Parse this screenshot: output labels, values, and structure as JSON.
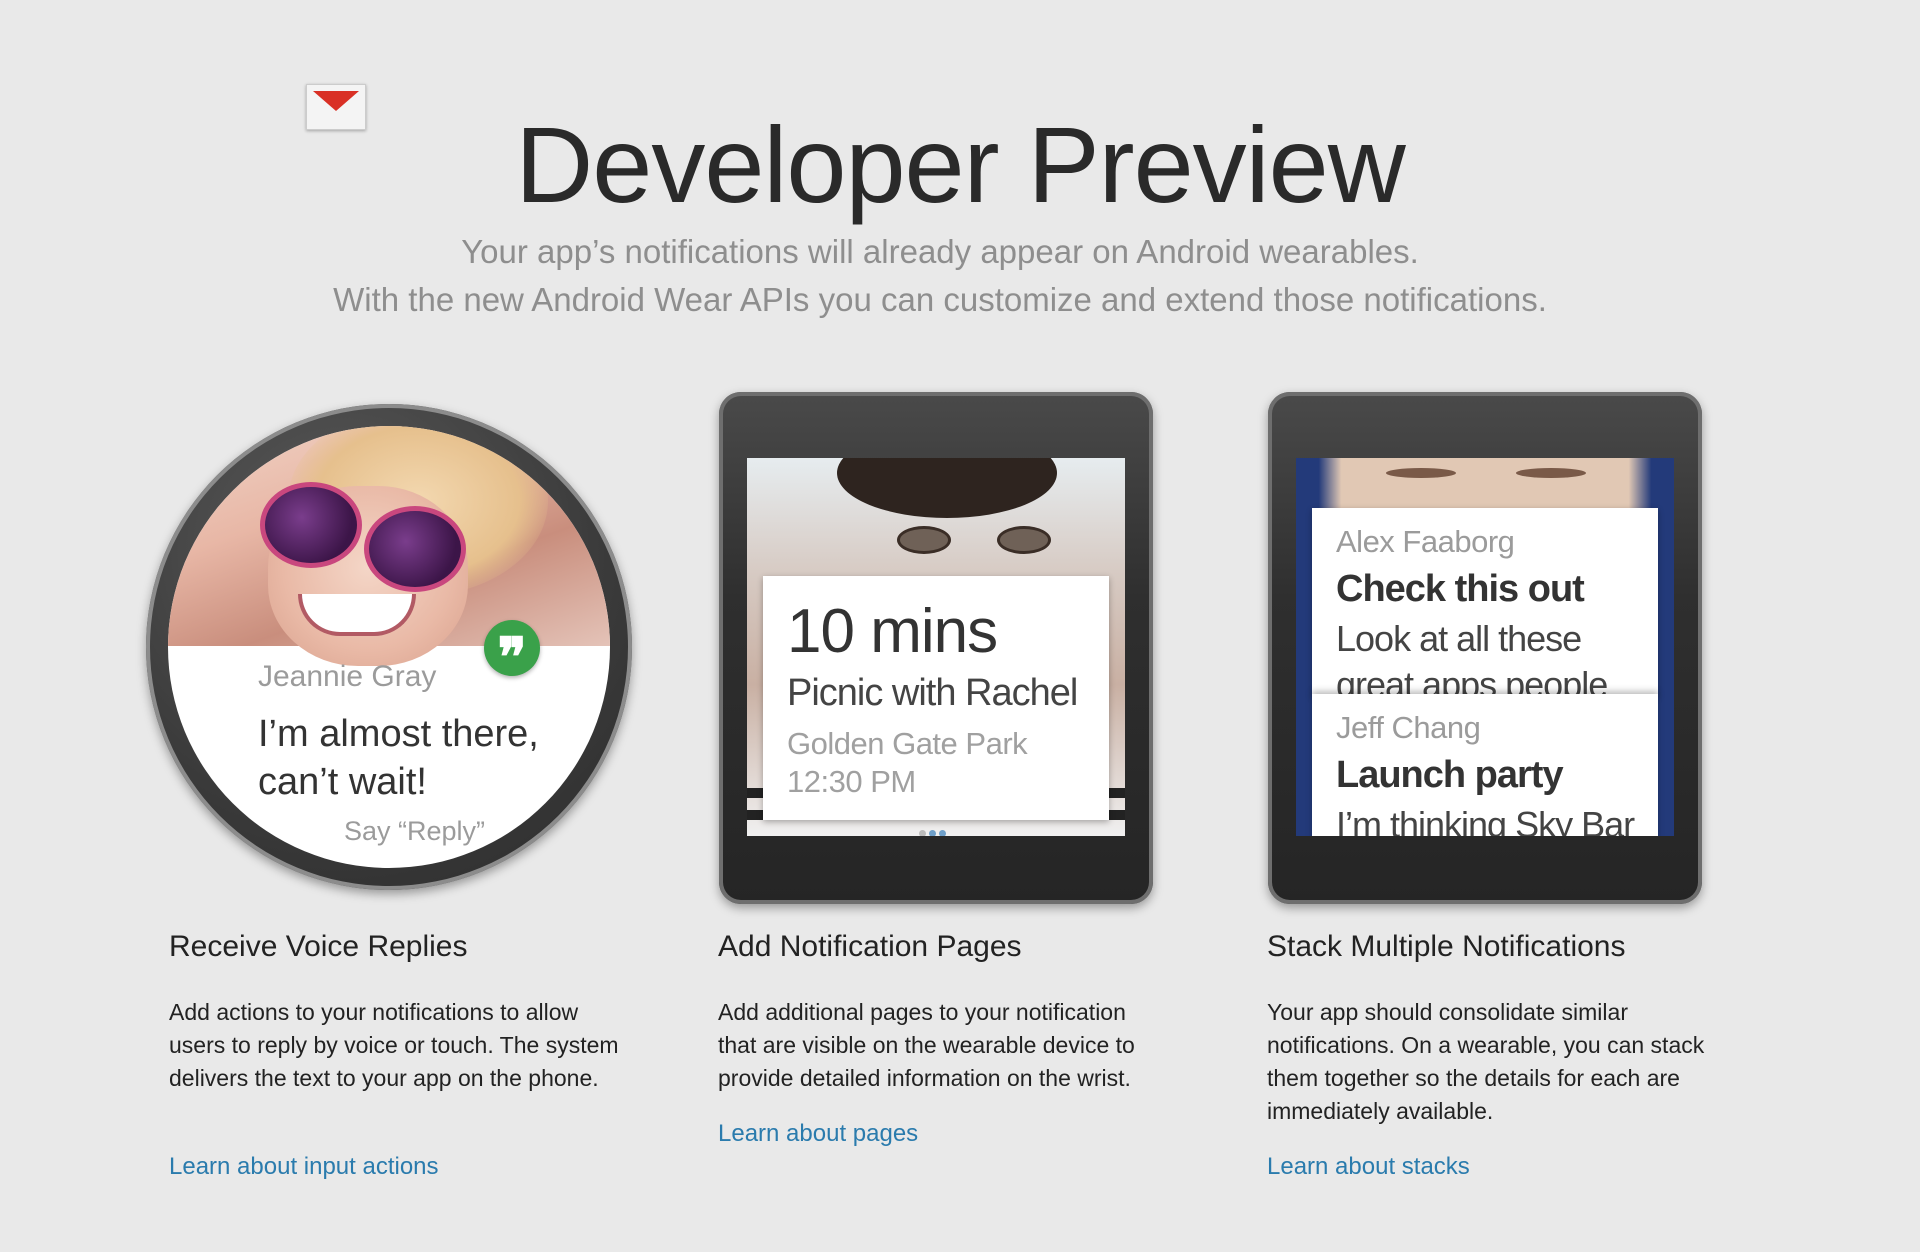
{
  "header": {
    "title": "Developer Preview",
    "subtitle_line1": "Your app’s notifications will already appear on Android wearables.",
    "subtitle_line2": "With the new Android Wear APIs you can customize and extend those notifications."
  },
  "watches": {
    "round": {
      "sender": "Jeannie Gray",
      "message_line1": "I’m almost there,",
      "message_line2": "can’t wait!",
      "hint": "Say “Reply”",
      "badge_icon": "hangouts-icon",
      "badge_glyph": "❞"
    },
    "pages": {
      "time": "10 mins",
      "event": "Picnic with Rachel",
      "location": "Golden Gate Park",
      "clock": "12:30 PM"
    },
    "stacks": {
      "card1": {
        "sender": "Alex Faaborg",
        "subject": "Check this out",
        "body_line1": "Look at all these",
        "body_line2": "great apps people are"
      },
      "card2": {
        "sender": "Jeff Chang",
        "subject": "Launch party",
        "body_line1": "I’m thinking Sky Bar"
      },
      "app_icon": "gmail-icon"
    }
  },
  "features": [
    {
      "title": "Receive Voice Replies",
      "description": "Add actions to your notifications to allow users to reply by voice or touch. The system delivers the text to your app on the phone.",
      "link": "Learn about input actions"
    },
    {
      "title": "Add Notification Pages",
      "description": "Add additional pages to your notification that are visible on the wearable device to provide detailed information on the wrist.",
      "link": "Learn about pages"
    },
    {
      "title": "Stack Multiple Notifications",
      "description": "Your app should consolidate similar notifications. On a wearable, you can stack them together so the details for each are immediately available.",
      "link": "Learn about stacks"
    }
  ],
  "colors": {
    "background": "#e9e9e9",
    "link": "#2a7bad",
    "hangouts_green": "#3aa14a",
    "gmail_red": "#d93025"
  }
}
